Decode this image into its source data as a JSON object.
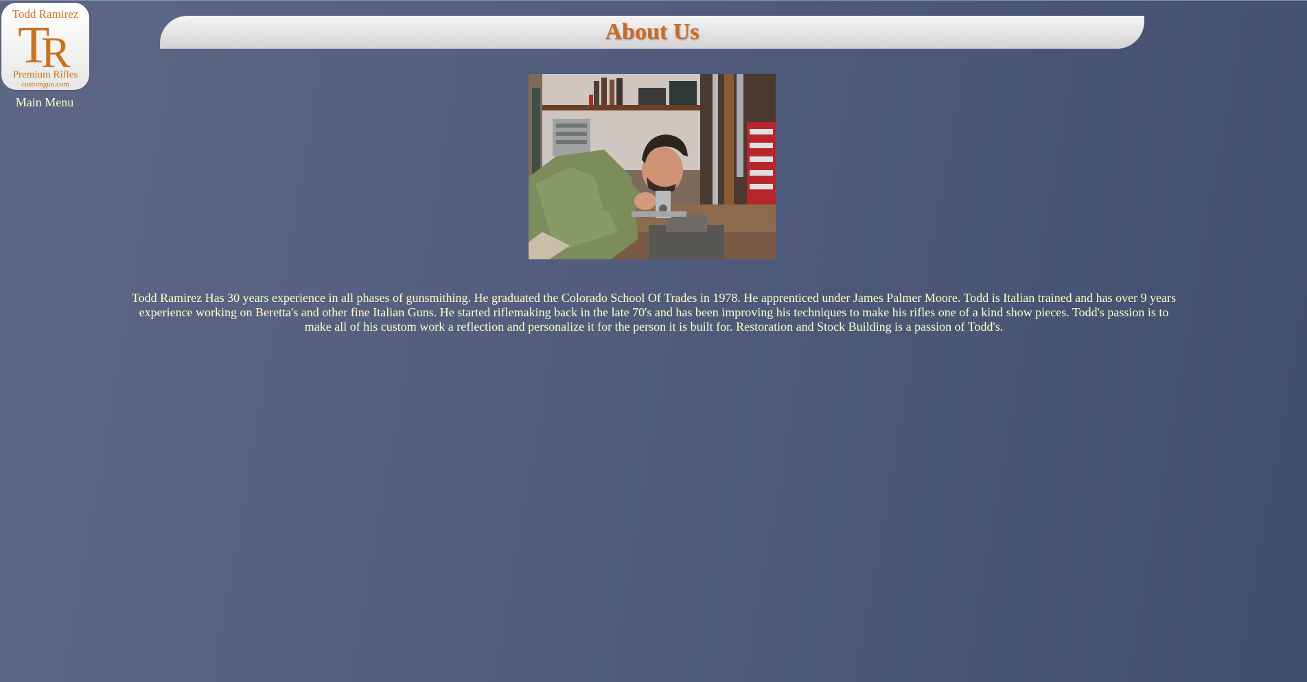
{
  "logo": {
    "top_text": "Todd Ramirez",
    "monogram_t": "T",
    "monogram_r": "R",
    "subtitle": "Premium Rifles",
    "url_text": "customgun.com",
    "accent_color": "#c8741e"
  },
  "nav": {
    "main_menu_label": "Main Menu"
  },
  "page": {
    "title": "About Us",
    "title_color": "#d0681c",
    "text_color": "#ffffc8"
  },
  "photo": {
    "subject": "gunsmith-at-workbench-image"
  },
  "bio": {
    "text": "Todd Ramirez Has 30 years experience in all phases of gunsmithing. He graduated the Colorado School Of Trades in 1978. He apprenticed under James Palmer Moore. Todd is Italian trained and has over 9 years experience working on Beretta's and other fine Italian Guns. He started riflemaking back in the late 70's and has been improving his techniques to make his rifles one of a kind show pieces. Todd's passion is to make all of his custom work a reflection and personalize it for the person it is built for. Restoration and Stock Building is a passion of Todd's."
  }
}
